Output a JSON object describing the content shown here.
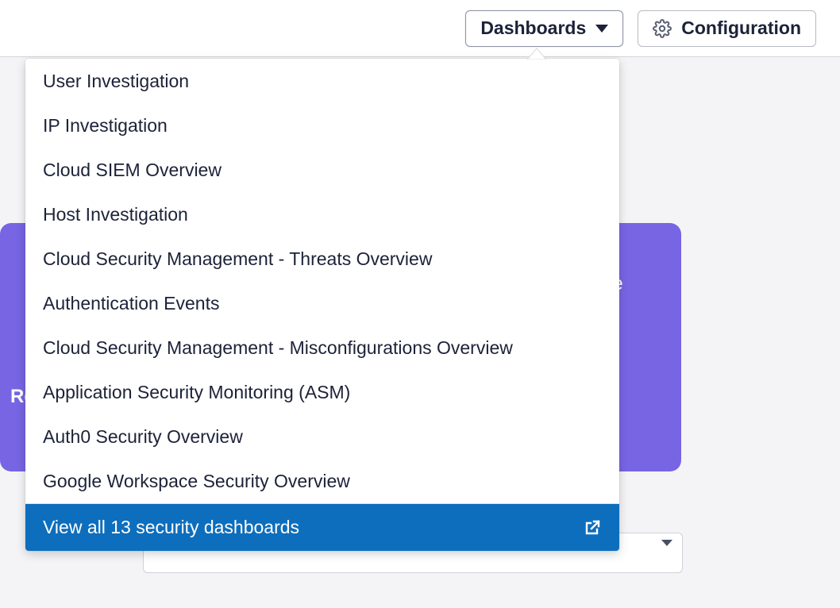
{
  "header": {
    "dashboards_label": "Dashboards",
    "configuration_label": "Configuration"
  },
  "purple": {
    "text1": "le",
    "text2": "Re"
  },
  "dropdown": {
    "items": [
      "User Investigation",
      "IP Investigation",
      "Cloud SIEM Overview",
      "Host Investigation",
      "Cloud Security Management - Threats Overview",
      "Authentication Events",
      "Cloud Security Management - Misconfigurations Overview",
      "Application Security Monitoring (ASM)",
      "Auth0 Security Overview",
      "Google Workspace Security Overview"
    ],
    "footer_label": "View all 13 security dashboards"
  }
}
